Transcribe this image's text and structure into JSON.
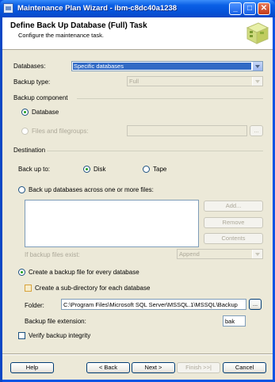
{
  "window": {
    "title": "Maintenance Plan Wizard - ibm-c8dc40a1238",
    "buttons": {
      "minimize": "_",
      "maximize": "□",
      "close": "✕"
    }
  },
  "header": {
    "title": "Define Back Up Database (Full) Task",
    "subtitle": "Configure the maintenance task."
  },
  "form": {
    "databases_label": "Databases:",
    "databases_value": "Specific databases",
    "backup_type_label": "Backup type:",
    "backup_type_value": "Full",
    "backup_component_label": "Backup component",
    "database_option": "Database",
    "files_option": "Files and filegroups:",
    "files_browse": "...",
    "destination_label": "Destination",
    "back_up_to_label": "Back up to:",
    "disk_option": "Disk",
    "tape_option": "Tape",
    "across_files_option": "Back up databases across one or more files:",
    "add_button": "Add...",
    "remove_button": "Remove",
    "contents_button": "Contents",
    "if_exists_label": "If backup files exist:",
    "if_exists_value": "Append",
    "per_db_option": "Create a backup file for every database",
    "subdir_check": "Create a sub-directory for each database",
    "folder_label": "Folder:",
    "folder_value": "C:\\Program Files\\Microsoft SQL Server\\MSSQL.1\\MSSQL\\Backup",
    "folder_browse": "...",
    "extension_label": "Backup file extension:",
    "extension_value": "bak",
    "verify_check": "Verify backup integrity"
  },
  "footer": {
    "help": "Help",
    "back": "< Back",
    "next": "Next >",
    "finish": "Finish >>|",
    "cancel": "Cancel"
  },
  "colors": {
    "title_bar": "#0a54e3",
    "dialog_bg": "#ece9d8",
    "selection": "#316ac5"
  }
}
